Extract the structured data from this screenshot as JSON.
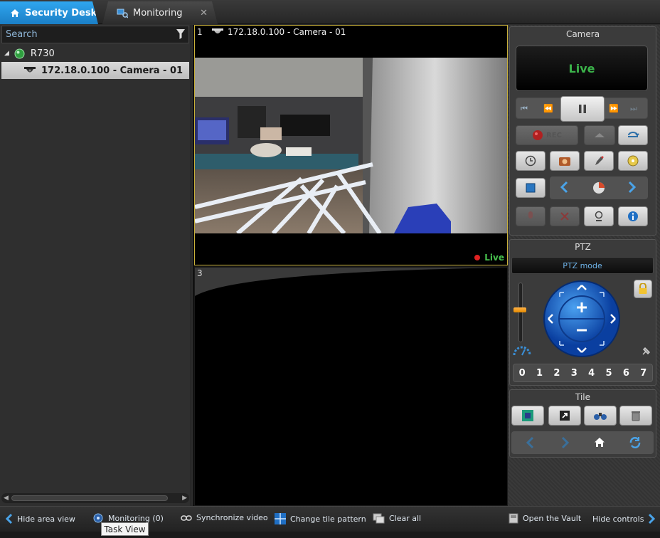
{
  "tabs": [
    {
      "label": "Security Desk",
      "active": true
    },
    {
      "label": "Monitoring",
      "active": false
    }
  ],
  "left_panel": {
    "search_placeholder": "Search",
    "tree": [
      {
        "label": "R730",
        "expanded": true
      },
      {
        "label": "172.18.0.100 - Camera - 01",
        "selected": true
      }
    ]
  },
  "tiles": [
    {
      "number": "1",
      "title": "172.18.0.100 - Camera - 01",
      "status": "Live",
      "highlighted": true
    },
    {
      "number": "3",
      "title": "",
      "status": ""
    }
  ],
  "camera_panel": {
    "title": "Camera",
    "live_text": "Live",
    "rec_label": "REC"
  },
  "ptz_panel": {
    "title": "PTZ",
    "mode_label": "PTZ mode",
    "presets": [
      "0",
      "1",
      "2",
      "3",
      "4",
      "5",
      "6",
      "7"
    ],
    "zoom_level": 0.55
  },
  "tile_panel": {
    "title": "Tile"
  },
  "bottom_bar": {
    "hide_area_view": "Hide area view",
    "monitoring": "Monitoring (0)",
    "synchronize_video": "Synchronize video",
    "change_tile_pattern": "Change tile pattern",
    "clear_all": "Clear all",
    "open_vault": "Open the Vault",
    "hide_controls": "Hide controls"
  },
  "tooltip": "Task View",
  "colors": {
    "accent": "#1f8ed8",
    "live_green": "#3bb34a",
    "tile_highlight": "#c9b13a",
    "record_red": "#e02222"
  }
}
